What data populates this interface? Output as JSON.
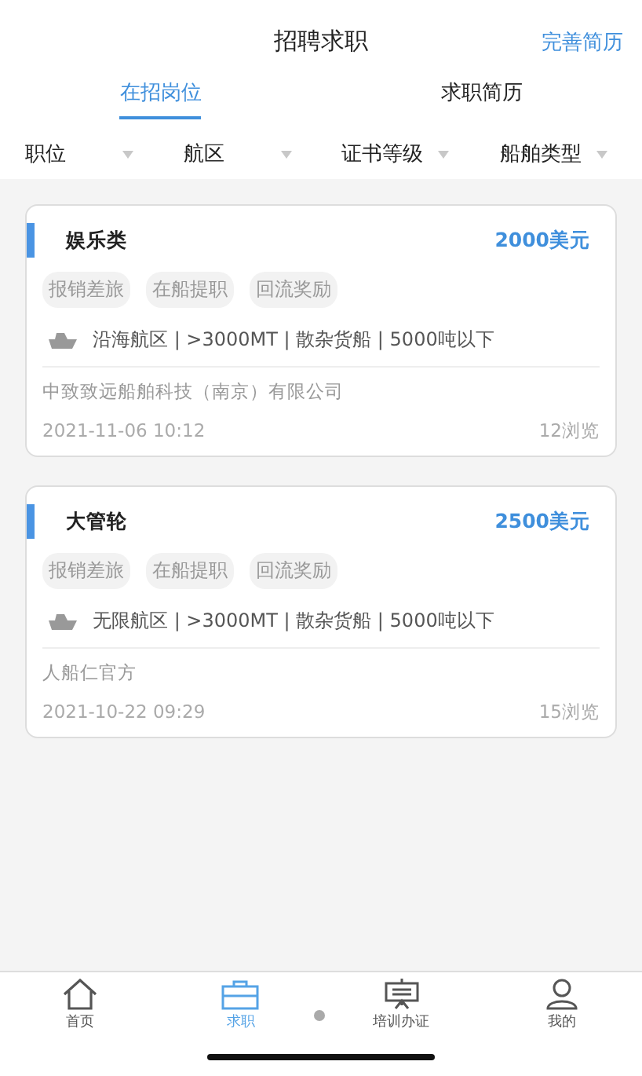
{
  "header": {
    "title": "招聘求职",
    "action": "完善简历"
  },
  "tabs": [
    {
      "label": "在招岗位",
      "selected": true
    },
    {
      "label": "求职简历",
      "selected": false
    }
  ],
  "filters": [
    {
      "label": "职位"
    },
    {
      "label": "航区"
    },
    {
      "label": "证书等级"
    },
    {
      "label": "船舶类型"
    }
  ],
  "jobs": [
    {
      "title": "娱乐类",
      "salary": "2000美元",
      "tags": [
        "报销差旅",
        "在船提职",
        "回流奖励"
      ],
      "details": "沿海航区 | >3000MT | 散杂货船 | 5000吨以下",
      "company": "中致致远船舶科技（南京）有限公司",
      "date": "2021-11-06 10:12",
      "views": "12浏览"
    },
    {
      "title": "大管轮",
      "salary": "2500美元",
      "tags": [
        "报销差旅",
        "在船提职",
        "回流奖励"
      ],
      "details": "无限航区 | >3000MT | 散杂货船 | 5000吨以下",
      "company": "人船仁官方",
      "date": "2021-10-22 09:29",
      "views": "15浏览"
    }
  ],
  "nav": [
    {
      "label": "首页",
      "kind": "home",
      "selected": false
    },
    {
      "label": "求职",
      "kind": "job",
      "selected": true
    },
    {
      "label": "培训办证",
      "kind": "training",
      "selected": false
    },
    {
      "label": "我的",
      "kind": "profile",
      "selected": false
    }
  ]
}
